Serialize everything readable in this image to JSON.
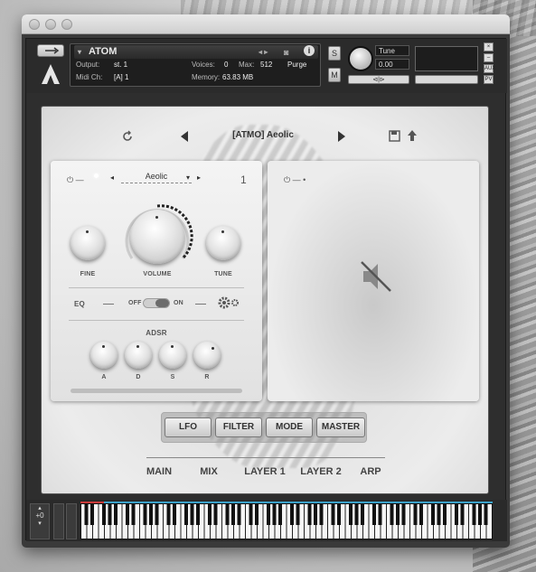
{
  "header": {
    "instrument_name": "ATOM",
    "output_label": "Output:",
    "output_value": "st. 1",
    "voices_label": "Voices:",
    "voices_value": "0",
    "max_label": "Max:",
    "max_value": "512",
    "purge_label": "Purge",
    "midi_label": "Midi Ch:",
    "midi_value": "[A]  1",
    "memory_label": "Memory:",
    "memory_value": "63.83 MB",
    "solo_label": "S",
    "mute_label": "M",
    "tune_label": "Tune",
    "tune_value": "0.00",
    "pan_label": "⊲|⊳",
    "side_aux": "AUX",
    "side_pv": "PV"
  },
  "preset": {
    "name": "[ATMO] Aeolic"
  },
  "layer1": {
    "sample_name": "Aeolic",
    "layer_number": "1",
    "fine_label": "FINE",
    "volume_label": "VOLUME",
    "tune_label": "TUNE",
    "eq_label": "EQ",
    "off_label": "OFF",
    "on_label": "ON",
    "adsr_label": "ADSR",
    "a_label": "A",
    "d_label": "D",
    "s_label": "S",
    "r_label": "R"
  },
  "bottom_tabs": [
    "LFO",
    "FILTER",
    "MODE",
    "MASTER"
  ],
  "nav_tabs": [
    "MAIN",
    "MIX",
    "LAYER 1",
    "LAYER 2",
    "ARP"
  ],
  "keyboard": {
    "octave_label": "+0"
  },
  "colors": {
    "keyboard_accent": "#3aa0c8",
    "keyboard_range_low": "#c93a3a"
  }
}
